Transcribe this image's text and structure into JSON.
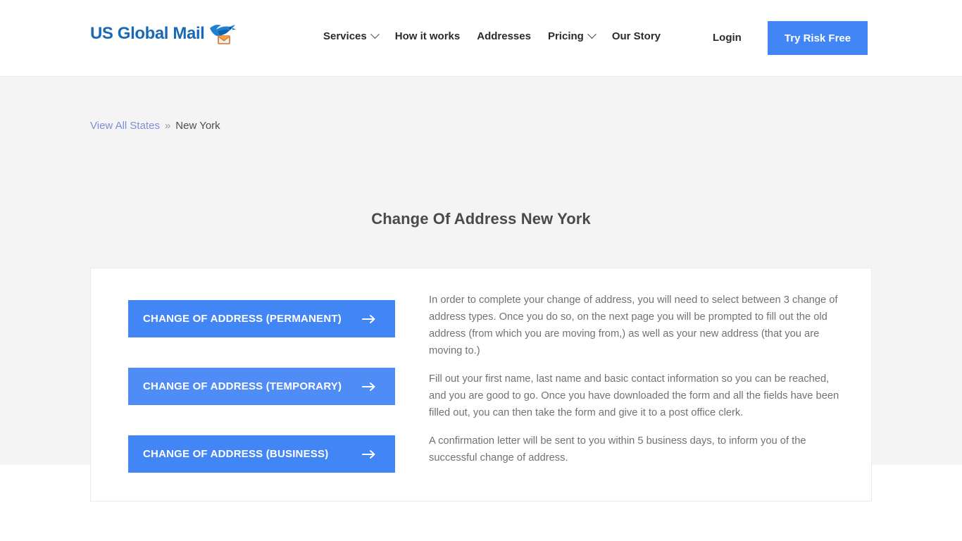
{
  "header": {
    "logo": {
      "text": "US Global Mail",
      "icon": "bird-envelope-logo-icon",
      "color": "#1a69b5"
    },
    "nav": [
      {
        "label": "Services",
        "has_dropdown": true,
        "icon": "chevron-down-icon"
      },
      {
        "label": "How it works",
        "has_dropdown": false
      },
      {
        "label": "Addresses",
        "has_dropdown": false
      },
      {
        "label": "Pricing",
        "has_dropdown": true,
        "icon": "chevron-down-icon"
      },
      {
        "label": "Our Story",
        "has_dropdown": false
      }
    ],
    "login_label": "Login",
    "cta_label": "Try Risk Free",
    "cta_color": "#4285f4"
  },
  "breadcrumb": {
    "link_label": "View All States",
    "separator": "»",
    "current": "New York"
  },
  "page_title": "Change Of Address New York",
  "card": {
    "buttons": [
      {
        "label": "CHANGE OF ADDRESS (PERMANENT)",
        "icon": "arrow-right-icon"
      },
      {
        "label": "CHANGE OF ADDRESS (TEMPORARY)",
        "icon": "arrow-right-icon"
      },
      {
        "label": "CHANGE OF ADDRESS (BUSINESS)",
        "icon": "arrow-right-icon"
      }
    ],
    "paragraphs": [
      "In order to complete your change of address, you will need to select between 3 change of address types. Once you do so, on the next page you will be prompted to fill out the old address (from which you are moving from,) as well as your new address (that you are moving to.)",
      "Fill out your first name, last name and basic contact information so you can be reached, and you are good to go. Once you have downloaded the form and all the fields have been filled out, you can then take the form and give it to a post office clerk.",
      "A confirmation letter will be sent to you within 5 business days, to inform you of the successful change of address."
    ]
  },
  "colors": {
    "accent_blue": "#4285f4",
    "page_gray": "#f4f4f4",
    "body_text": "#6f7275"
  }
}
